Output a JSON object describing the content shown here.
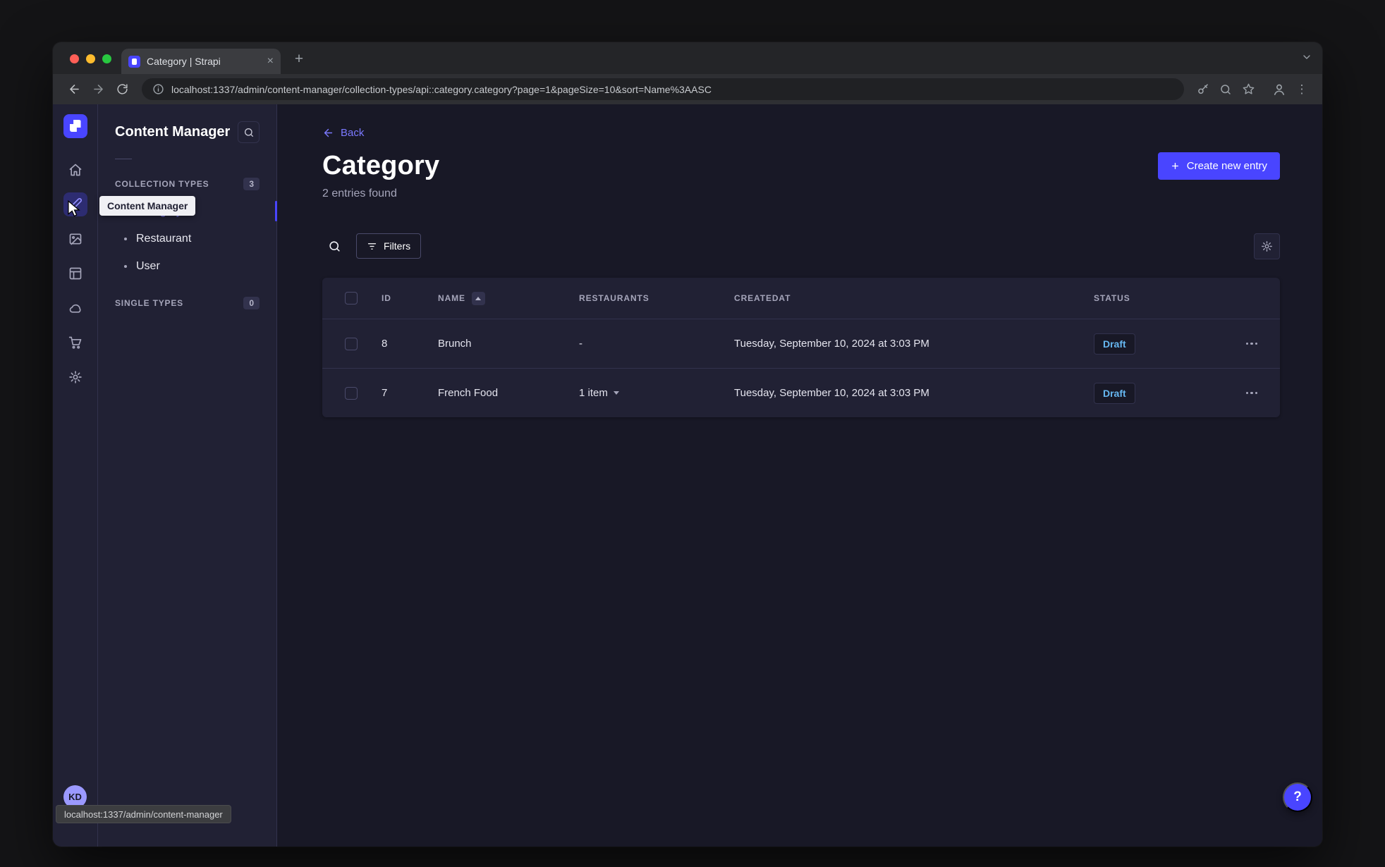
{
  "browser": {
    "tab_title": "Category | Strapi",
    "url": "localhost:1337/admin/content-manager/collection-types/api::category.category?page=1&pageSize=10&sort=Name%3AASC",
    "status_link": "localhost:1337/admin/content-manager"
  },
  "nav": {
    "tooltip": "Content Manager",
    "avatar_initials": "KD",
    "items": [
      {
        "icon": "home-icon",
        "active": false
      },
      {
        "icon": "content-manager-icon",
        "active": true
      },
      {
        "icon": "media-library-icon",
        "active": false
      },
      {
        "icon": "content-type-builder-icon",
        "active": false
      },
      {
        "icon": "deploy-icon",
        "active": false
      },
      {
        "icon": "marketplace-icon",
        "active": false
      },
      {
        "icon": "settings-icon",
        "active": false
      }
    ]
  },
  "sidebar": {
    "title": "Content Manager",
    "collection_types_label": "COLLECTION TYPES",
    "collection_types_count": "3",
    "items": [
      {
        "label": "Category",
        "active": true
      },
      {
        "label": "Restaurant",
        "active": false
      },
      {
        "label": "User",
        "active": false
      }
    ],
    "single_types_label": "SINGLE TYPES",
    "single_types_count": "0"
  },
  "content": {
    "back_label": "Back",
    "title": "Category",
    "subtitle": "2 entries found",
    "create_button": "Create new entry",
    "filters_button": "Filters"
  },
  "table": {
    "headers": {
      "id": "ID",
      "name": "NAME",
      "restaurants": "RESTAURANTS",
      "createdat": "CREATEDAT",
      "status": "STATUS"
    },
    "rows": [
      {
        "id": "8",
        "name": "Brunch",
        "restaurants": "-",
        "createdat": "Tuesday, September 10, 2024 at 3:03 PM",
        "status": "Draft"
      },
      {
        "id": "7",
        "name": "French Food",
        "restaurants": "1 item",
        "createdat": "Tuesday, September 10, 2024 at 3:03 PM",
        "status": "Draft"
      }
    ]
  },
  "help_button": "?",
  "colors": {
    "accent": "#4945ff",
    "link": "#7b79ff",
    "draft_text": "#66b7f1",
    "sidebar_bg": "#212134",
    "content_bg": "#181826",
    "border": "#32324d"
  }
}
